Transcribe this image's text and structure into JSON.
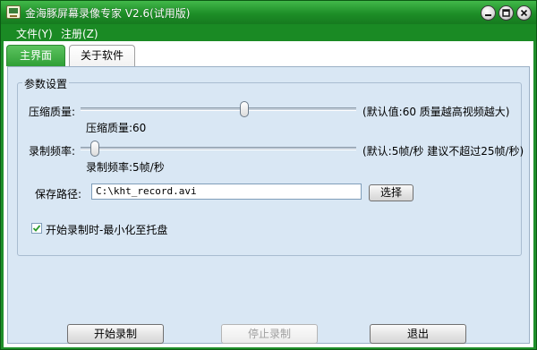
{
  "window": {
    "title": "金海豚屏幕录像专家 V2.6(试用版)",
    "accent_color": "#1f8f2a",
    "controls": {
      "minimize_icon": "minimize-icon",
      "maximize_icon": "maximize-icon",
      "close_icon": "close-icon"
    }
  },
  "menu": {
    "items": [
      {
        "label": "文件(Y)"
      },
      {
        "label": "注册(Z)"
      }
    ]
  },
  "tabs": [
    {
      "label": "主界面",
      "active": true
    },
    {
      "label": "关于软件",
      "active": false
    }
  ],
  "settings": {
    "group_title": "参数设置",
    "compression": {
      "label": "压缩质量:",
      "value_text": "压缩质量:60",
      "hint": "(默认值:60 质量越高视频越大)",
      "value": 60,
      "min": 0,
      "max": 100
    },
    "frame_rate": {
      "label": "录制频率:",
      "value_text": "录制频率:5帧/秒",
      "hint": "(默认:5帧/秒 建议不超过25帧/秒)",
      "value": 5,
      "min": 1,
      "max": 100
    },
    "save_path": {
      "label": "保存路径:",
      "value": "C:\\kht_record.avi",
      "browse_label": "选择"
    },
    "minimize_on_start": {
      "label": "开始录制时-最小化至托盘",
      "checked": true
    }
  },
  "actions": {
    "start_label": "开始录制",
    "stop_label": "停止录制",
    "stop_enabled": false,
    "exit_label": "退出"
  }
}
